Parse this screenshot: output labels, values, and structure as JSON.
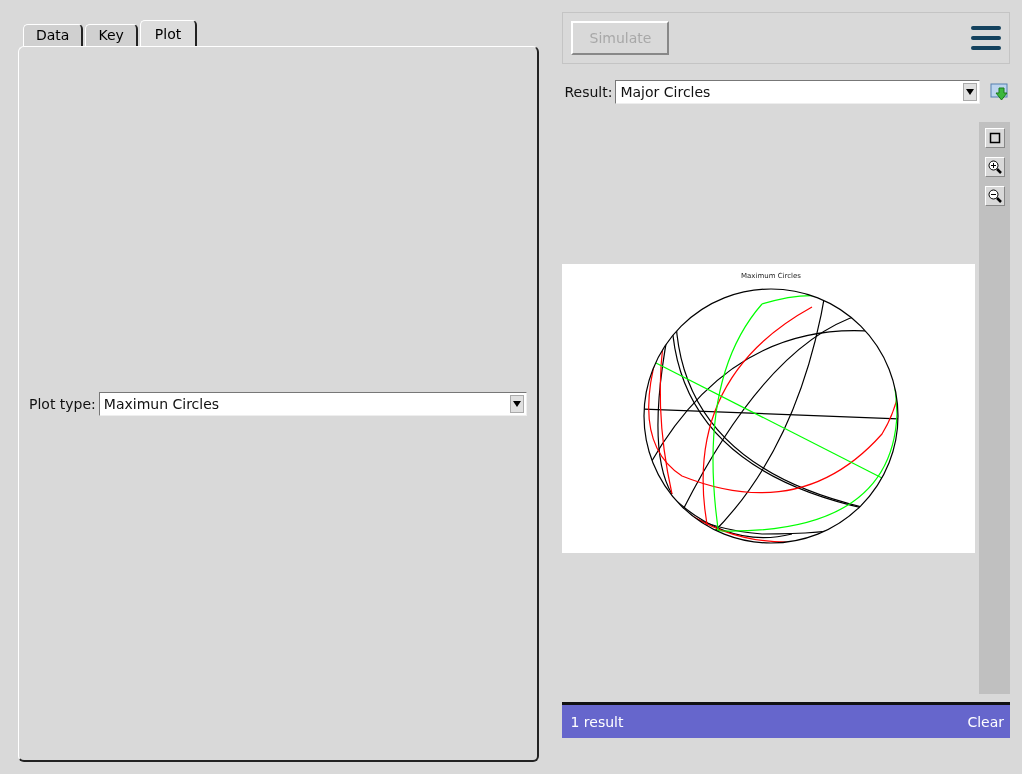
{
  "tabs": [
    {
      "label": "Data",
      "selected": false
    },
    {
      "label": "Key",
      "selected": false
    },
    {
      "label": "Plot",
      "selected": true
    }
  ],
  "plot_type": {
    "label": "Plot type:",
    "value": "Maximun Circles"
  },
  "toolbar": {
    "simulate": {
      "label": "Simulate",
      "disabled": true
    }
  },
  "result": {
    "label": "Result:",
    "value": "Major Circles"
  },
  "plot": {
    "title": "Maximum Circles"
  },
  "status_bar": {
    "count": "1 result",
    "clear": "Clear"
  }
}
